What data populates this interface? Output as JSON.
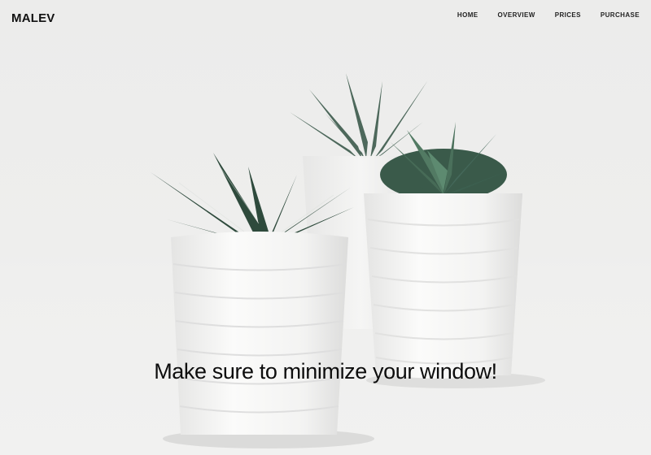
{
  "brand": {
    "name": "MALEV"
  },
  "nav": {
    "items": [
      {
        "label": "HOME"
      },
      {
        "label": "OVERVIEW"
      },
      {
        "label": "PRICES"
      },
      {
        "label": "PURCHASE"
      }
    ]
  },
  "hero": {
    "headline": "Make sure to minimize your window!",
    "image": "three-succulent-pots-photo"
  },
  "colors": {
    "background": "#ecedec",
    "text": "#111111",
    "leaf_dark": "#2c4a3a",
    "pot": "#f7f7f6"
  }
}
